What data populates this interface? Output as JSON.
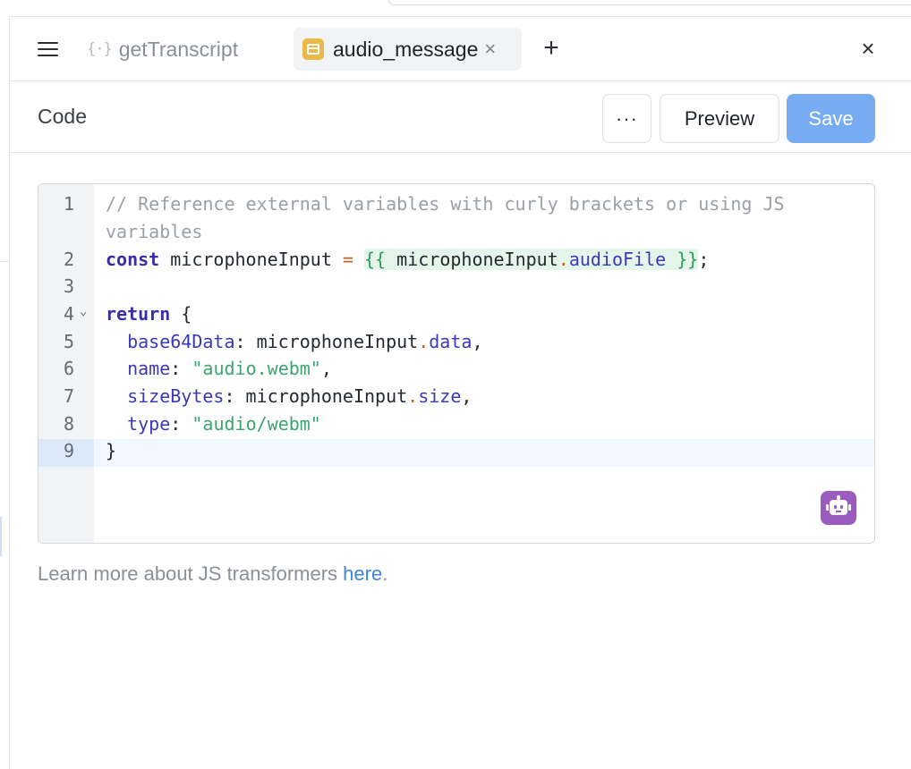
{
  "tabs": {
    "inactive": {
      "icon": "{·}",
      "label": "getTranscript"
    },
    "active": {
      "label": "audio_message",
      "close": "×"
    },
    "add": "+",
    "panel_close": "×"
  },
  "toolbar": {
    "title": "Code",
    "more_label": "···",
    "preview_label": "Preview",
    "save_label": "Save"
  },
  "editor": {
    "line_numbers": [
      "1",
      "2",
      "3",
      "4",
      "5",
      "6",
      "7",
      "8",
      "9"
    ],
    "fold_marker": "⌄",
    "lines": {
      "l1a": "// Reference external variables with curly brackets or using JS",
      "l1b": "variables",
      "l2_kw": "const",
      "l2_var": " microphoneInput ",
      "l2_eq": "=",
      "l2_open": "{{",
      "l2_obj": " microphoneInput",
      "l2_dot": ".",
      "l2_prop": "audioFile",
      "l2_close": " }}",
      "l2_semi": ";",
      "l4_kw": "return",
      "l4_brace": " {",
      "l5_key": "base64Data",
      "l5_colon": ": microphoneInput",
      "l5_dot": ".",
      "l5_prop": "data",
      "l5_comma": ",",
      "l6_key": "name",
      "l6_colon": ": ",
      "l6_str": "\"audio.webm\"",
      "l6_comma": ",",
      "l7_key": "sizeBytes",
      "l7_colon": ": microphoneInput",
      "l7_dot": ".",
      "l7_prop": "size",
      "l7_comma": ",",
      "l8_key": "type",
      "l8_colon": ": ",
      "l8_str": "\"audio/webm\"",
      "l9": "}"
    }
  },
  "footer": {
    "text": "Learn more about JS transformers ",
    "link": "here",
    "period": "."
  },
  "colors": {
    "save_button": "#77acf2",
    "tab_icon": "#e9b949",
    "ai_button": "#9b5cc0",
    "link": "#3f86d9"
  }
}
